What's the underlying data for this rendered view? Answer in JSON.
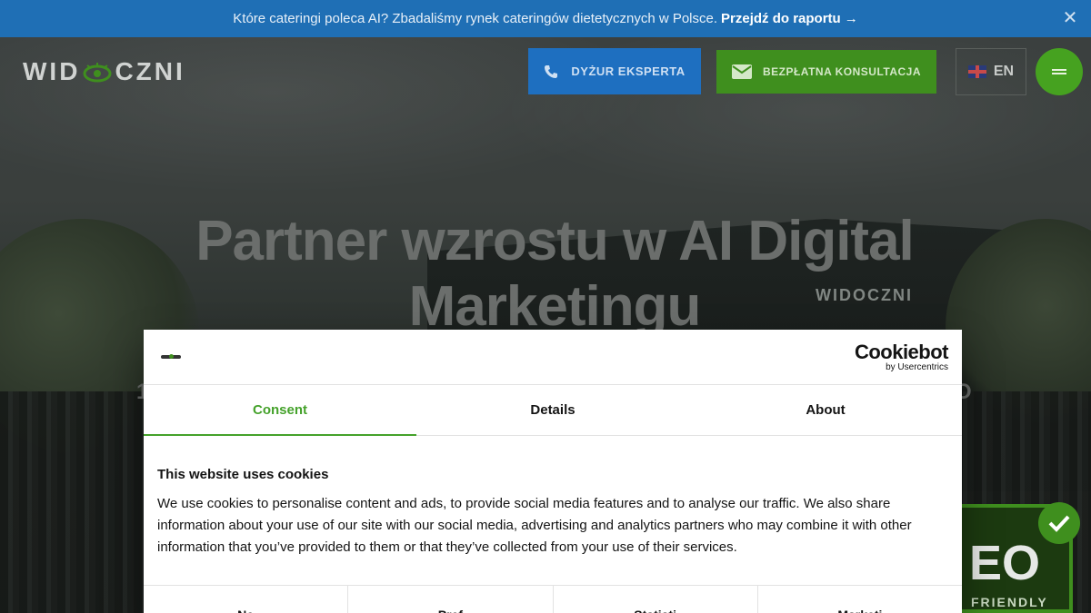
{
  "announcement": {
    "text": "Które cateringi poleca AI? Zbadaliśmy rynek cateringów dietetycznych w Polsce.",
    "link": "Przejdź do raportu",
    "arrow": "→",
    "close": "✕"
  },
  "header": {
    "logo_left": "WID",
    "logo_right": "CZNI",
    "expert_button": "DYŻUR EKSPERTA",
    "consult_button": "BEZPŁATNA KONSULTACJA",
    "language": "EN"
  },
  "hero": {
    "title": "Partner wzrostu w AI Digital Marketingu",
    "faint_left": "1",
    "faint_right": "O",
    "building_logo": "WIDOCZNI",
    "badge_top": "EO",
    "badge_bottom": "FRIENDLY"
  },
  "cookie_dialog": {
    "brand": "Cookiebot",
    "brand_by": "by Usercentrics",
    "tabs": [
      "Consent",
      "Details",
      "About"
    ],
    "heading": "This website uses cookies",
    "body": "We use cookies to personalise content and ads, to provide social media features and to analyse our traffic. We also share information about your use of our site with our social media, advertising and analytics partners who may combine it with other information that you’ve provided to them or that they’ve collected from your use of their services.",
    "categories": [
      "Ne",
      "Pref",
      "Statisti",
      "Marketi"
    ]
  },
  "colors": {
    "announcement_bg": "#1f6fb5",
    "expert_bg": "#1e6fc0",
    "consult_bg": "#3f8f1e",
    "menu_bg": "#46a220",
    "active_tab": "#45a22b"
  }
}
